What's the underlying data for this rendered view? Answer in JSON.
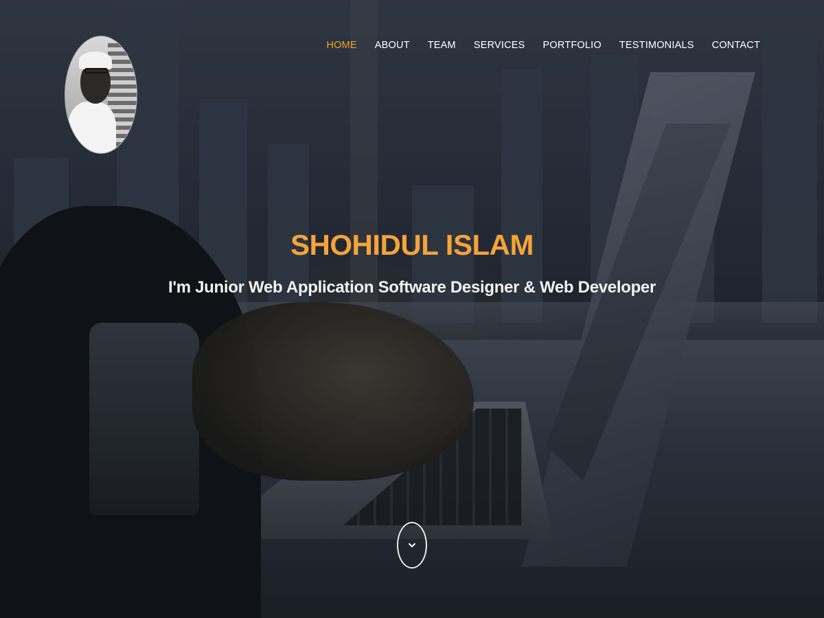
{
  "profile": {
    "name": "SHOHIDUL ISLAM",
    "tagline": "I'm Junior Web Application Software Designer & Web Developer"
  },
  "nav": {
    "items": [
      {
        "label": "HOME",
        "active": true
      },
      {
        "label": "ABOUT",
        "active": false
      },
      {
        "label": "TEAM",
        "active": false
      },
      {
        "label": "SERVICES",
        "active": false
      },
      {
        "label": "PORTFOLIO",
        "active": false
      },
      {
        "label": "TESTIMONIALS",
        "active": false
      },
      {
        "label": "CONTACT",
        "active": false
      }
    ]
  },
  "scroll_button": {
    "icon": "chevron-down-icon"
  },
  "colors": {
    "accent": "#f5a623",
    "title": "#f5a33a",
    "text": "#ffffff"
  }
}
